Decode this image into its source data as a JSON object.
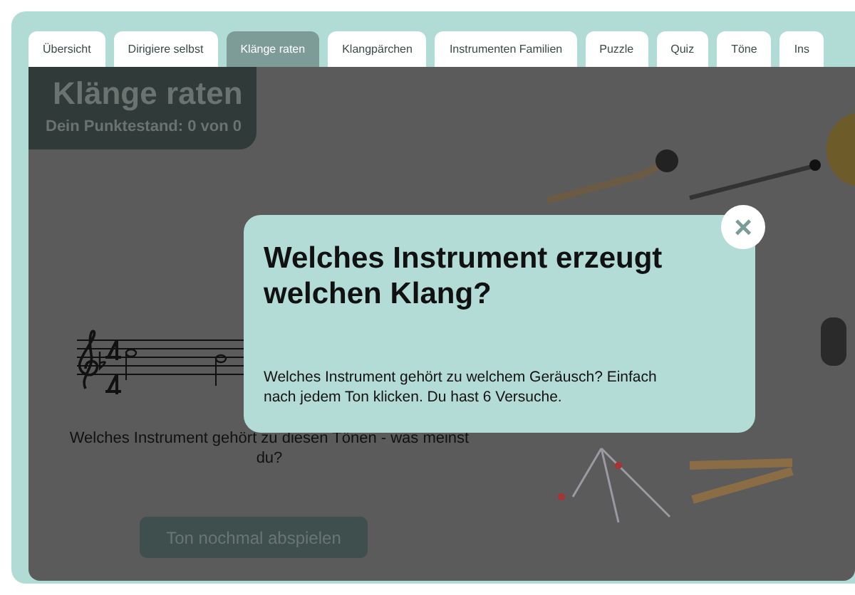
{
  "tabs": [
    {
      "label": "Übersicht",
      "selected": false
    },
    {
      "label": "Dirigiere selbst",
      "selected": false
    },
    {
      "label": "Klänge raten",
      "selected": true
    },
    {
      "label": "Klangpärchen",
      "selected": false
    },
    {
      "label": "Instrumenten Familien",
      "selected": false
    },
    {
      "label": "Puzzle",
      "selected": false
    },
    {
      "label": "Quiz",
      "selected": false
    },
    {
      "label": "Töne",
      "selected": false
    },
    {
      "label": "Ins",
      "selected": false
    }
  ],
  "game": {
    "title": "Klänge raten",
    "score": "Dein Punktestand: 0 von 0",
    "question": "Welches Instrument gehört zu diesen Tönen - was meinst du?",
    "replay_button": "Ton nochmal abspielen"
  },
  "dialog": {
    "title": "Welches Instrument erzeugt welchen Klang?",
    "text": "Welches Instrument gehört zu welchem Geräusch? Einfach nach jedem Ton klicken. Du hast 6 Versuche.",
    "close": "×"
  }
}
